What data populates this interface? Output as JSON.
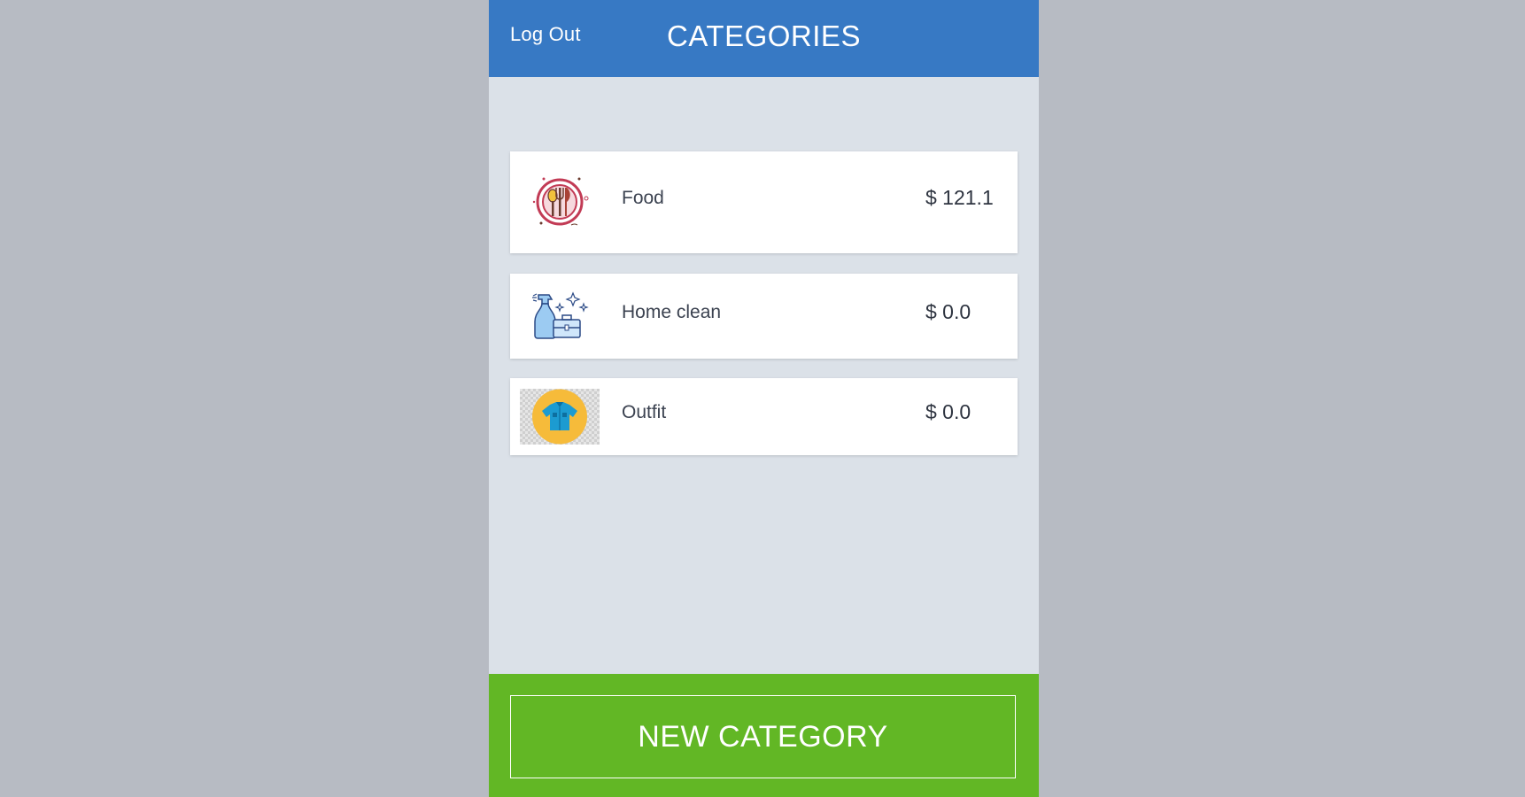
{
  "header": {
    "logout_label": "Log Out",
    "title": "CATEGORIES",
    "background_color": "#3779c4"
  },
  "categories": [
    {
      "name": "Food",
      "amount": "$ 121.1",
      "icon": "dining-plate-icon"
    },
    {
      "name": "Home clean",
      "amount": "$ 0.0",
      "icon": "cleaning-spray-icon"
    },
    {
      "name": "Outfit",
      "amount": "$ 0.0",
      "icon": "shirt-icon"
    }
  ],
  "footer": {
    "new_category_label": "NEW CATEGORY",
    "background_color": "#62b725"
  }
}
